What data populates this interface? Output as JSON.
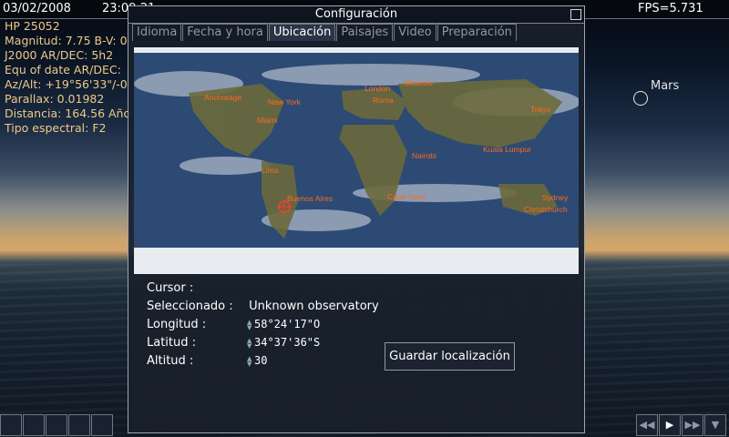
{
  "topbar": {
    "date": "03/02/2008",
    "time": "23:09:21",
    "fps": "FPS=5.731"
  },
  "object_info": [
    "HP 25052",
    "Magnitud: 7.75 B-V: 0",
    "J2000 AR/DEC:    5h2",
    "Equ of date AR/DEC:",
    "Az/Alt: +19°56'33\"/-0",
    "Parallax: 0.01982",
    "Distancia: 164.56 Año",
    "Tipo espectral: F2"
  ],
  "sky": {
    "planet_label": "Mars"
  },
  "dialog": {
    "title": "Configuración",
    "tabs": [
      "Idioma",
      "Fecha y hora",
      "Ubicación",
      "Paisajes",
      "Video",
      "Preparación"
    ],
    "active_tab": "Ubicación",
    "map_cities": [
      "Anchorage",
      "New York",
      "Miami",
      "London",
      "Roma",
      "Moscow",
      "Tokyo",
      "Kuala Lumpur",
      "Nairobi",
      "Cape Town",
      "Buenos Aires",
      "Lima",
      "Sydney",
      "Christchurch"
    ],
    "cursor_label": "Cursor :",
    "selected_label": "Seleccionado :",
    "selected_value": "Unknown observatory",
    "longitude_label": "Longitud :",
    "longitude_value": "58°24'17\"O",
    "latitude_label": "Latitud :",
    "latitude_value": "34°37'36\"S",
    "altitude_label": "Altitud :",
    "altitude_value": "30",
    "save_button": "Guardar localización"
  },
  "colors": {
    "city_label": "#ff6a1a",
    "info_text": "#f0c98a"
  }
}
